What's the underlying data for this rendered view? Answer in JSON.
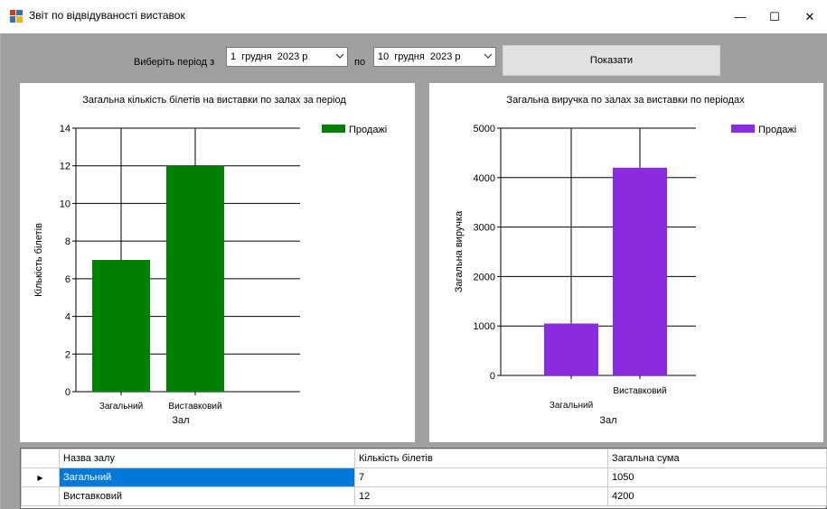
{
  "window": {
    "title": "Звіт по відвідуваності виставок",
    "controls": {
      "minimize": "—",
      "maximize": "☐",
      "close": "✕"
    }
  },
  "filter": {
    "period_label": "Виберіть період з",
    "from": {
      "day": "1",
      "month": "грудня",
      "year": "2023 р"
    },
    "to_label": "по",
    "to": {
      "day": "10",
      "month": "грудня",
      "year": "2023 р"
    },
    "show_button": "Показати"
  },
  "charts": {
    "accent_colors": {
      "tickets": "#008000",
      "revenue": "#8a2be2"
    }
  },
  "chart_data": [
    {
      "type": "bar",
      "title": "Загальна кількість білетів на виставки по залах за період",
      "xlabel": "Зал",
      "ylabel": "Кількість білетів",
      "categories": [
        "Загальний",
        "Виставковий"
      ],
      "series": [
        {
          "name": "Продажі",
          "values": [
            7,
            12
          ],
          "color": "#008000"
        }
      ],
      "ylim": [
        0,
        14
      ],
      "yticks": [
        0,
        2,
        4,
        6,
        8,
        10,
        12,
        14
      ],
      "legend": "top-right",
      "grid": true
    },
    {
      "type": "bar",
      "title": "Загальна виручка по залах за виставки по періодах",
      "xlabel": "Зал",
      "ylabel": "Загальна виручка",
      "categories": [
        "Загальний",
        "Виставковий"
      ],
      "series": [
        {
          "name": "Продажі",
          "values": [
            1050,
            4200
          ],
          "color": "#8a2be2"
        }
      ],
      "ylim": [
        0,
        5000
      ],
      "yticks": [
        0,
        1000,
        2000,
        3000,
        4000,
        5000
      ],
      "legend": "top-right",
      "grid": true
    }
  ],
  "grid": {
    "columns": [
      "Назва залу",
      "Кількість білетів",
      "Загальна сума"
    ],
    "rows": [
      [
        "Загальний",
        "7",
        "1050"
      ],
      [
        "Виставковий",
        "12",
        "4200"
      ]
    ],
    "current_row_marker": "▶"
  }
}
